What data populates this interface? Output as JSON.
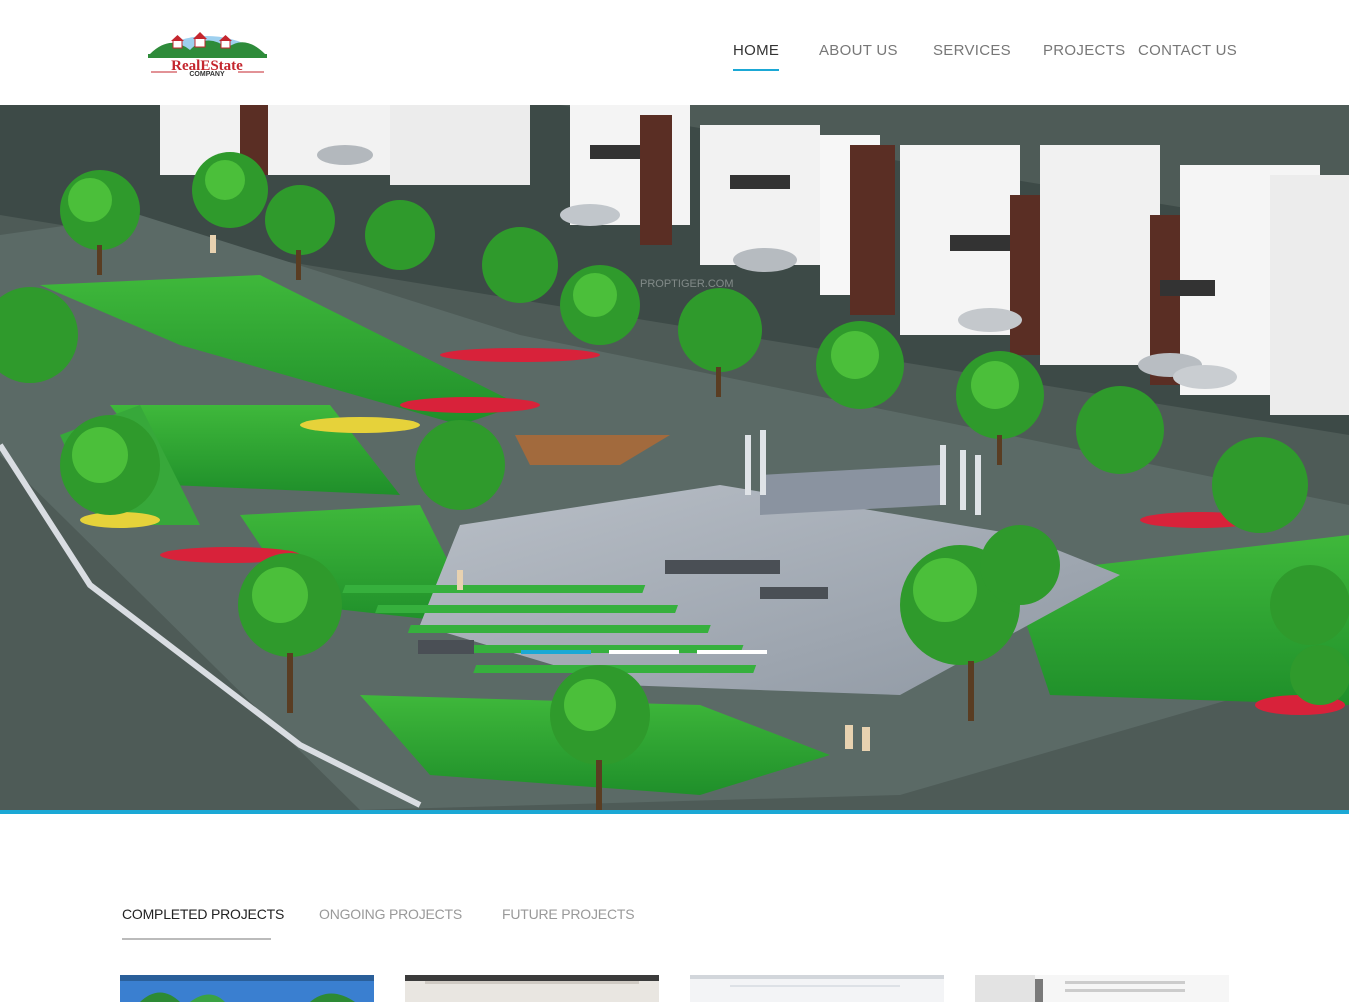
{
  "brand": {
    "logo_line1": "RealEState",
    "logo_line2": "COMPANY",
    "logo_red": "#c4262e",
    "logo_green": "#2e8b3a"
  },
  "nav": {
    "items": [
      {
        "label": "HOME",
        "active": true
      },
      {
        "label": "ABOUT US",
        "active": false
      },
      {
        "label": "SERVICES",
        "active": false
      },
      {
        "label": "PROJECTS",
        "active": false
      },
      {
        "label": "CONTACT US",
        "active": false
      }
    ]
  },
  "hero": {
    "slide_count": 3,
    "active_slide": 1,
    "watermark": "PROPTIGER.COM"
  },
  "projects": {
    "tabs": [
      {
        "label": "COMPLETED PROJECTS",
        "active": true
      },
      {
        "label": "ONGOING PROJECTS",
        "active": false
      },
      {
        "label": "FUTURE PROJECTS",
        "active": false
      }
    ]
  },
  "colors": {
    "accent": "#1ba8d5",
    "nav_text": "#777777",
    "tab_inactive": "#999999"
  }
}
